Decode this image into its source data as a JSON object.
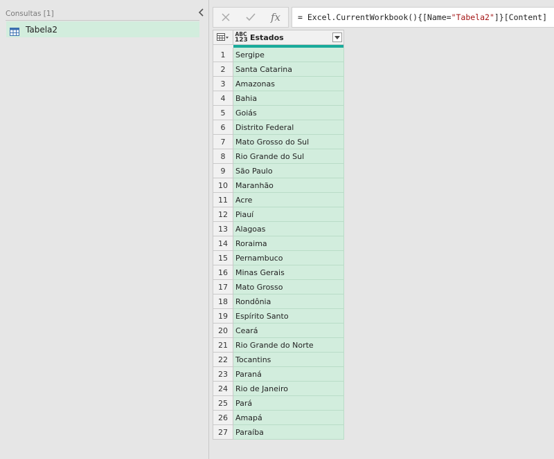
{
  "queries_pane": {
    "header": "Consultas [1]",
    "items": [
      {
        "label": "Tabela2",
        "icon": "table-icon",
        "selected": true
      }
    ]
  },
  "formula_bar": {
    "cancel_icon": "close-icon",
    "commit_icon": "check-icon",
    "fx_label": "fx",
    "formula": {
      "prefix": "= Excel.CurrentWorkbook(){[Name=",
      "string": "\"Tabela2\"",
      "suffix": "]}[Content]"
    }
  },
  "grid": {
    "column": {
      "name": "Estados",
      "type_top": "ABC",
      "type_bottom": "123"
    },
    "quality_color": "#1aab9b",
    "rows": [
      {
        "n": "1",
        "value": "Sergipe"
      },
      {
        "n": "2",
        "value": "Santa Catarina"
      },
      {
        "n": "3",
        "value": "Amazonas"
      },
      {
        "n": "4",
        "value": "Bahia"
      },
      {
        "n": "5",
        "value": "Goiás"
      },
      {
        "n": "6",
        "value": "Distrito Federal"
      },
      {
        "n": "7",
        "value": "Mato Grosso do Sul"
      },
      {
        "n": "8",
        "value": "Rio Grande do Sul"
      },
      {
        "n": "9",
        "value": "São Paulo"
      },
      {
        "n": "10",
        "value": "Maranhão"
      },
      {
        "n": "11",
        "value": "Acre"
      },
      {
        "n": "12",
        "value": "Piauí"
      },
      {
        "n": "13",
        "value": "Alagoas"
      },
      {
        "n": "14",
        "value": "Roraima"
      },
      {
        "n": "15",
        "value": "Pernambuco"
      },
      {
        "n": "16",
        "value": "Minas Gerais"
      },
      {
        "n": "17",
        "value": "Mato Grosso"
      },
      {
        "n": "18",
        "value": "Rondônia"
      },
      {
        "n": "19",
        "value": "Espírito Santo"
      },
      {
        "n": "20",
        "value": "Ceará"
      },
      {
        "n": "21",
        "value": "Rio Grande do Norte"
      },
      {
        "n": "22",
        "value": "Tocantins"
      },
      {
        "n": "23",
        "value": "Paraná"
      },
      {
        "n": "24",
        "value": "Rio de Janeiro"
      },
      {
        "n": "25",
        "value": "Pará"
      },
      {
        "n": "26",
        "value": "Amapá"
      },
      {
        "n": "27",
        "value": "Paraíba"
      }
    ]
  }
}
